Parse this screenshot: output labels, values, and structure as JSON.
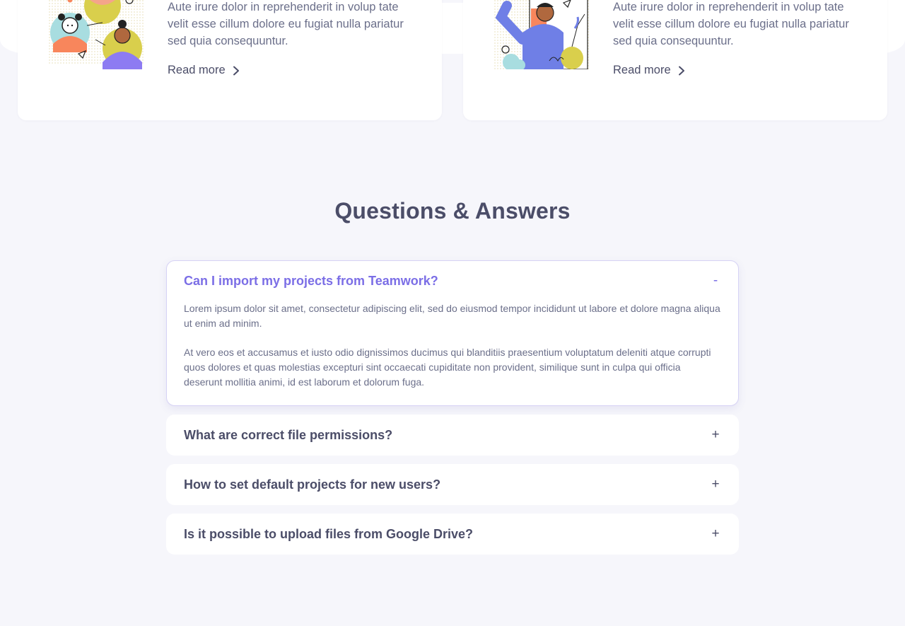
{
  "cards": [
    {
      "text": "Aute irure dolor in reprehenderit in volup tate velit esse cillum dolore eu fugiat nulla pariatur sed quia consequuntur.",
      "link_label": "Read more"
    },
    {
      "text": "Aute irure dolor in reprehenderit in volup tate velit esse cillum dolore eu fugiat nulla pariatur sed quia consequuntur.",
      "link_label": "Read more"
    }
  ],
  "faq": {
    "title": "Questions & Answers",
    "items": [
      {
        "question": "Can I import my projects from Teamwork?",
        "toggle": "-",
        "expanded": true,
        "answers": [
          "Lorem ipsum dolor sit amet, consectetur adipiscing elit, sed do eiusmod tempor incididunt ut labore et dolore magna aliqua ut enim ad minim.",
          "At vero eos et accusamus et iusto odio dignissimos ducimus qui blanditiis praesentium voluptatum deleniti atque corrupti quos dolores et quas molestias excepturi sint occaecati cupiditate non provident, similique sunt in culpa qui officia deserunt mollitia animi, id est laborum et dolorum fuga."
        ]
      },
      {
        "question": "What are correct file permissions?",
        "toggle": "+",
        "expanded": false
      },
      {
        "question": "How to set default projects for new users?",
        "toggle": "+",
        "expanded": false
      },
      {
        "question": "Is it possible to upload files from Google Drive?",
        "toggle": "+",
        "expanded": false
      }
    ]
  },
  "colors": {
    "background": "#f6f6fb",
    "accent": "#7b6ee6",
    "heading": "#4b4d68",
    "body_text": "#6b6f8a"
  }
}
